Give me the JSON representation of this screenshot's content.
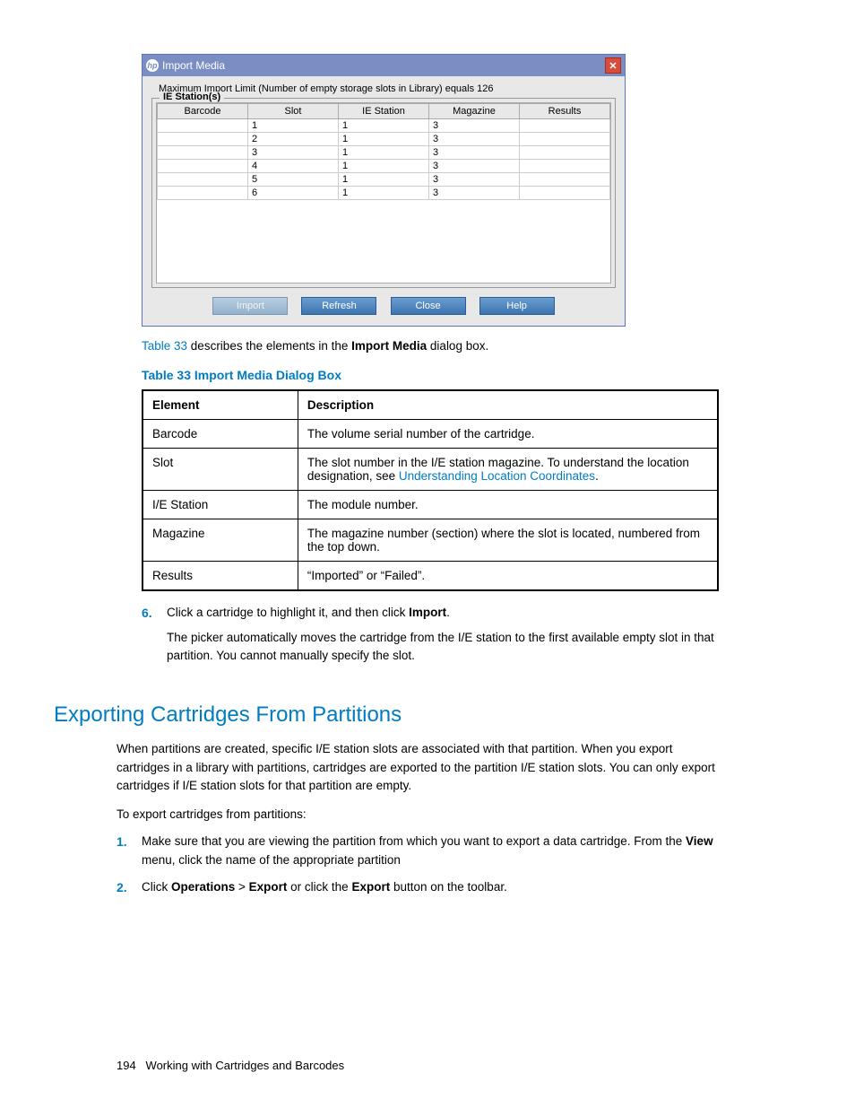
{
  "dialog": {
    "title": "Import Media",
    "close_glyph": "✕",
    "max_msg": "Maximum Import Limit (Number of empty storage slots in Library) equals 126",
    "fieldset_legend": "IE Station(s)",
    "columns": [
      "Barcode",
      "Slot",
      "IE Station",
      "Magazine",
      "Results"
    ],
    "rows": [
      {
        "barcode": "",
        "slot": "1",
        "ie": "1",
        "mag": "3",
        "res": ""
      },
      {
        "barcode": "",
        "slot": "2",
        "ie": "1",
        "mag": "3",
        "res": ""
      },
      {
        "barcode": "",
        "slot": "3",
        "ie": "1",
        "mag": "3",
        "res": ""
      },
      {
        "barcode": "",
        "slot": "4",
        "ie": "1",
        "mag": "3",
        "res": ""
      },
      {
        "barcode": "",
        "slot": "5",
        "ie": "1",
        "mag": "3",
        "res": ""
      },
      {
        "barcode": "",
        "slot": "6",
        "ie": "1",
        "mag": "3",
        "res": ""
      }
    ],
    "buttons": {
      "import": "Import",
      "refresh": "Refresh",
      "close": "Close",
      "help": "Help"
    }
  },
  "caption_ref": {
    "pre": "Table 33",
    "mid": " describes the elements in the ",
    "bold": "Import Media",
    "post": " dialog box."
  },
  "table_caption": "Table 33 Import Media Dialog Box",
  "desc_headers": {
    "element": "Element",
    "description": "Description"
  },
  "desc_rows": {
    "barcode": {
      "el": "Barcode",
      "txt": "The volume serial number of the cartridge."
    },
    "slot": {
      "el": "Slot",
      "pre": "The slot number in the I/E station magazine. To understand the location designation, see ",
      "link": "Understanding Location Coordinates",
      "post": "."
    },
    "ie": {
      "el": "I/E Station",
      "txt": "The module number."
    },
    "mag": {
      "el": "Magazine",
      "txt": "The magazine number (section) where the slot is located, numbered from the top down."
    },
    "res": {
      "el": "Results",
      "txt": "“Imported” or “Failed”."
    }
  },
  "step6": {
    "num": "6.",
    "line1_pre": "Click a cartridge to highlight it, and then click ",
    "line1_bold": "Import",
    "line1_post": ".",
    "line2": "The picker automatically moves the cartridge from the I/E station to the first available empty slot in that partition. You cannot manually specify the slot."
  },
  "section_heading": "Exporting Cartridges From Partitions",
  "export_para": "When partitions are created, specific I/E station slots are associated with that partition. When you export cartridges in a library with partitions, cartridges are exported to the partition I/E station slots. You can only export cartridges if I/E station slots for that partition are empty.",
  "export_intro": "To export cartridges from partitions:",
  "export_steps": {
    "s1": {
      "num": "1.",
      "pre": "Make sure that you are viewing the partition from which you want to export a data cartridge. From the ",
      "b1": "View",
      "post": " menu, click the name of the appropriate partition"
    },
    "s2": {
      "num": "2.",
      "p1": "Click ",
      "b1": "Operations",
      "p2": " > ",
      "b2": "Export",
      "p3": " or click the ",
      "b3": "Export",
      "p4": " button on the toolbar."
    }
  },
  "footer": {
    "page": "194",
    "title": "Working with Cartridges and Barcodes"
  }
}
